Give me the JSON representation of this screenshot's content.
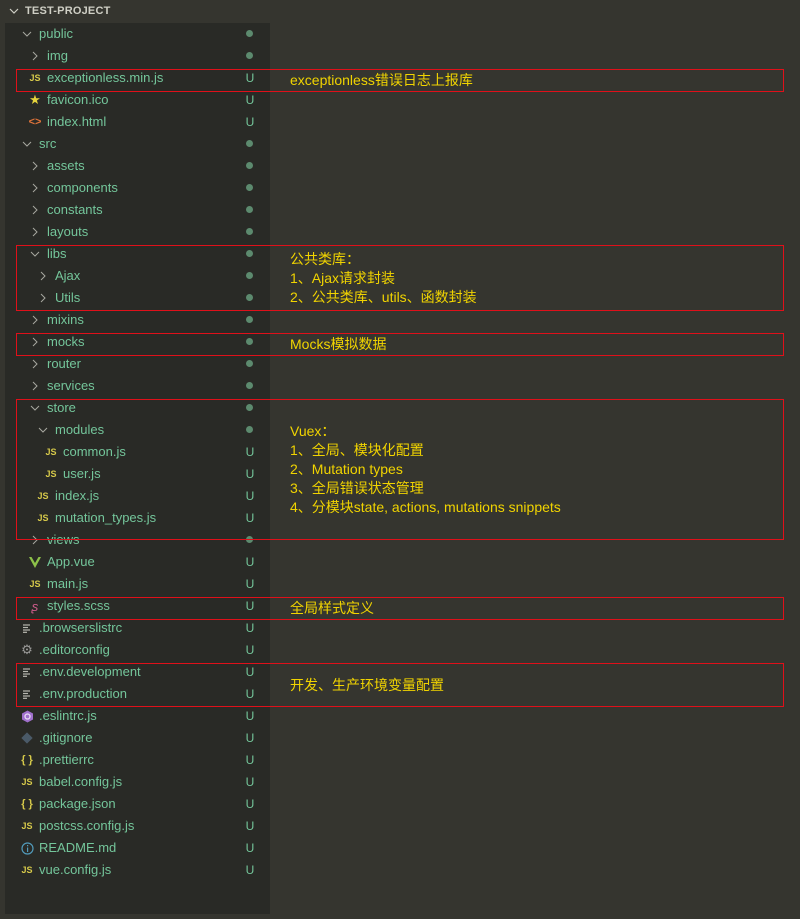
{
  "explorer": {
    "title": "TEST-PROJECT",
    "items": [
      {
        "name": "public",
        "type": "folder",
        "open": true,
        "depth": 0,
        "icon": "chevron-down-icon",
        "status": "dot"
      },
      {
        "name": "img",
        "type": "folder",
        "open": false,
        "depth": 1,
        "icon": "chevron-right-icon",
        "status": "dot"
      },
      {
        "name": "exceptionless.min.js",
        "type": "file",
        "depth": 1,
        "icon": "js-icon",
        "status": "U"
      },
      {
        "name": "favicon.ico",
        "type": "file",
        "depth": 1,
        "icon": "star-icon",
        "status": "U"
      },
      {
        "name": "index.html",
        "type": "file",
        "depth": 1,
        "icon": "html-icon",
        "status": "U"
      },
      {
        "name": "src",
        "type": "folder",
        "open": true,
        "depth": 0,
        "icon": "chevron-down-icon",
        "status": "dot"
      },
      {
        "name": "assets",
        "type": "folder",
        "open": false,
        "depth": 1,
        "icon": "chevron-right-icon",
        "status": "dot"
      },
      {
        "name": "components",
        "type": "folder",
        "open": false,
        "depth": 1,
        "icon": "chevron-right-icon",
        "status": "dot"
      },
      {
        "name": "constants",
        "type": "folder",
        "open": false,
        "depth": 1,
        "icon": "chevron-right-icon",
        "status": "dot"
      },
      {
        "name": "layouts",
        "type": "folder",
        "open": false,
        "depth": 1,
        "icon": "chevron-right-icon",
        "status": "dot"
      },
      {
        "name": "libs",
        "type": "folder",
        "open": true,
        "depth": 1,
        "icon": "chevron-down-icon",
        "status": "dot"
      },
      {
        "name": "Ajax",
        "type": "folder",
        "open": false,
        "depth": 2,
        "icon": "chevron-right-icon",
        "status": "dot"
      },
      {
        "name": "Utils",
        "type": "folder",
        "open": false,
        "depth": 2,
        "icon": "chevron-right-icon",
        "status": "dot"
      },
      {
        "name": "mixins",
        "type": "folder",
        "open": false,
        "depth": 1,
        "icon": "chevron-right-icon",
        "status": "dot"
      },
      {
        "name": "mocks",
        "type": "folder",
        "open": false,
        "depth": 1,
        "icon": "chevron-right-icon",
        "status": "dot"
      },
      {
        "name": "router",
        "type": "folder",
        "open": false,
        "depth": 1,
        "icon": "chevron-right-icon",
        "status": "dot"
      },
      {
        "name": "services",
        "type": "folder",
        "open": false,
        "depth": 1,
        "icon": "chevron-right-icon",
        "status": "dot"
      },
      {
        "name": "store",
        "type": "folder",
        "open": true,
        "depth": 1,
        "icon": "chevron-down-icon",
        "status": "dot"
      },
      {
        "name": "modules",
        "type": "folder",
        "open": true,
        "depth": 2,
        "icon": "chevron-down-icon",
        "status": "dot"
      },
      {
        "name": "common.js",
        "type": "file",
        "depth": 3,
        "icon": "js-icon",
        "status": "U"
      },
      {
        "name": "user.js",
        "type": "file",
        "depth": 3,
        "icon": "js-icon",
        "status": "U"
      },
      {
        "name": "index.js",
        "type": "file",
        "depth": 2,
        "icon": "js-icon",
        "status": "U"
      },
      {
        "name": "mutation_types.js",
        "type": "file",
        "depth": 2,
        "icon": "js-icon",
        "status": "U"
      },
      {
        "name": "views",
        "type": "folder",
        "open": false,
        "depth": 1,
        "icon": "chevron-right-icon",
        "status": "dot"
      },
      {
        "name": "App.vue",
        "type": "file",
        "depth": 1,
        "icon": "vue-icon",
        "status": "U"
      },
      {
        "name": "main.js",
        "type": "file",
        "depth": 1,
        "icon": "js-icon",
        "status": "U"
      },
      {
        "name": "styles.scss",
        "type": "file",
        "depth": 1,
        "icon": "sass-icon",
        "status": "U"
      },
      {
        "name": ".browserslistrc",
        "type": "file",
        "depth": 0,
        "icon": "lines-icon",
        "status": "U"
      },
      {
        "name": ".editorconfig",
        "type": "file",
        "depth": 0,
        "icon": "gear-icon",
        "status": "U"
      },
      {
        "name": ".env.development",
        "type": "file",
        "depth": 0,
        "icon": "lines-icon",
        "status": "U"
      },
      {
        "name": ".env.production",
        "type": "file",
        "depth": 0,
        "icon": "lines-icon",
        "status": "U"
      },
      {
        "name": ".eslintrc.js",
        "type": "file",
        "depth": 0,
        "icon": "eslint-icon",
        "status": "U"
      },
      {
        "name": ".gitignore",
        "type": "file",
        "depth": 0,
        "icon": "git-icon",
        "status": "U"
      },
      {
        "name": ".prettierrc",
        "type": "file",
        "depth": 0,
        "icon": "braces-icon",
        "status": "U"
      },
      {
        "name": "babel.config.js",
        "type": "file",
        "depth": 0,
        "icon": "js-icon",
        "status": "U"
      },
      {
        "name": "package.json",
        "type": "file",
        "depth": 0,
        "icon": "braces-icon",
        "status": "U"
      },
      {
        "name": "postcss.config.js",
        "type": "file",
        "depth": 0,
        "icon": "js-icon",
        "status": "U"
      },
      {
        "name": "README.md",
        "type": "file",
        "depth": 0,
        "icon": "info-icon",
        "status": "U"
      },
      {
        "name": "vue.config.js",
        "type": "file",
        "depth": 0,
        "icon": "js-icon",
        "status": "U"
      }
    ]
  },
  "annotations": [
    {
      "id": "exceptionless",
      "startRow": 2,
      "endRow": 2,
      "lines": [
        "exceptionless错误日志上报库"
      ]
    },
    {
      "id": "libs",
      "startRow": 10,
      "endRow": 12,
      "lines": [
        "公共类库：",
        "1、Ajax请求封装",
        "2、公共类库、utils、函数封装"
      ]
    },
    {
      "id": "mocks",
      "startRow": 14,
      "endRow": 14,
      "lines": [
        "Mocks模拟数据"
      ]
    },
    {
      "id": "vuex",
      "startRow": 17,
      "endRow": 22,
      "lines": [
        "Vuex：",
        "1、全局、模块化配置",
        "2、Mutation types",
        "3、全局错误状态管理",
        "4、分模块state, actions, mutations snippets"
      ]
    },
    {
      "id": "styles",
      "startRow": 26,
      "endRow": 26,
      "lines": [
        "全局样式定义"
      ]
    },
    {
      "id": "env",
      "startRow": 29,
      "endRow": 30,
      "lines": [
        "开发、生产环境变量配置"
      ]
    }
  ],
  "colors": {
    "background": "#35352f",
    "tree": "#292a26",
    "fileText": "#74c69b",
    "annotation": "#f1d400",
    "box": "#e0101a"
  }
}
